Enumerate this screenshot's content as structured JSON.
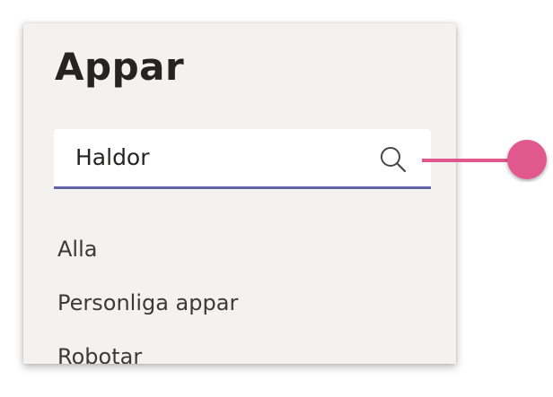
{
  "panel": {
    "title": "Appar",
    "search": {
      "value": "Haldor",
      "icon": "search-icon"
    },
    "nav_items": [
      {
        "label": "Alla"
      },
      {
        "label": "Personliga appar"
      },
      {
        "label": "Robotar"
      }
    ]
  },
  "colors": {
    "panel_bg": "#f3f2f1",
    "accent_underline": "#6264a7",
    "callout_pink": "#e1588f"
  }
}
